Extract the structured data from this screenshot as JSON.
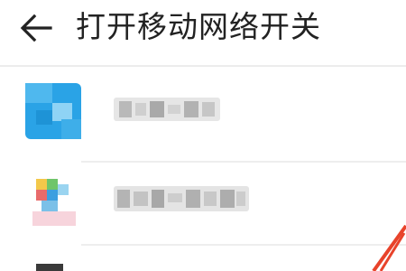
{
  "header": {
    "back_icon": "arrow-left-icon",
    "title": "打开移动网络开关"
  },
  "list": {
    "items": [
      {
        "icon": "app-icon-blue"
      },
      {
        "icon": "app-icon-multicolor"
      },
      {
        "icon": "app-icon-dark"
      }
    ]
  },
  "colors": {
    "title_text": "#222222",
    "icon_blue": "#2aa3e6",
    "annotation_arrow": "#e8432b"
  }
}
